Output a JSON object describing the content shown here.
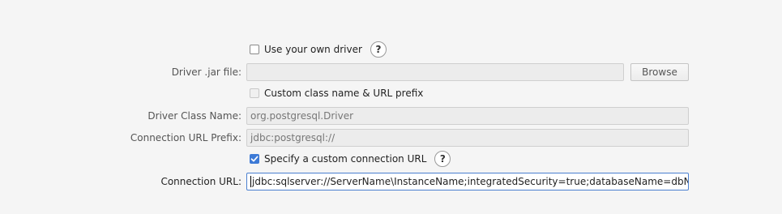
{
  "own_driver": {
    "label": "Use your own driver",
    "checked": false,
    "help_label": "?"
  },
  "driver_jar": {
    "label": "Driver .jar file:",
    "value": "",
    "browse_label": "Browse"
  },
  "custom_class": {
    "label": "Custom class name & URL prefix",
    "checked": false
  },
  "driver_class": {
    "label": "Driver Class Name:",
    "value": "org.postgresql.Driver"
  },
  "url_prefix": {
    "label": "Connection URL Prefix:",
    "value": "jdbc:postgresql://"
  },
  "custom_url": {
    "label": "Specify a custom connection URL",
    "checked": true,
    "help_label": "?"
  },
  "connection_url": {
    "label": "Connection URL:",
    "value": "jdbc:sqlserver://ServerName\\InstanceName;integratedSecurity=true;databaseName=dbName;"
  },
  "colors": {
    "accent": "#3d7ad6",
    "background": "#f5f5f5",
    "disabled_field": "#ececec"
  }
}
